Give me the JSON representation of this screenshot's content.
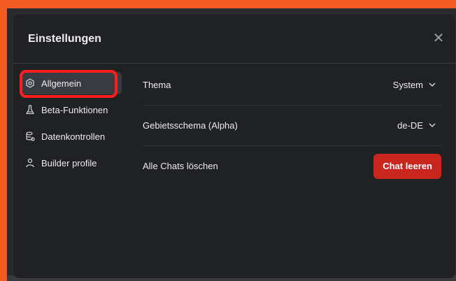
{
  "dialog": {
    "title": "Einstellungen",
    "close_icon": "close-icon"
  },
  "sidebar": {
    "items": [
      {
        "label": "Allgemein",
        "icon": "gear-icon",
        "active": true
      },
      {
        "label": "Beta-Funktionen",
        "icon": "flask-icon",
        "active": false
      },
      {
        "label": "Datenkontrollen",
        "icon": "database-icon",
        "active": false
      },
      {
        "label": "Builder profile",
        "icon": "user-icon",
        "active": false
      }
    ]
  },
  "settings": {
    "theme": {
      "label": "Thema",
      "value": "System"
    },
    "locale": {
      "label": "Gebietsschema (Alpha)",
      "value": "de-DE"
    },
    "clear_chats": {
      "label": "Alle Chats löschen",
      "button_label": "Chat leeren"
    }
  },
  "colors": {
    "accent_highlight": "#ff1e1e",
    "danger": "#c8261f",
    "background_outer": "#f25a22",
    "dialog_bg": "#202123"
  }
}
